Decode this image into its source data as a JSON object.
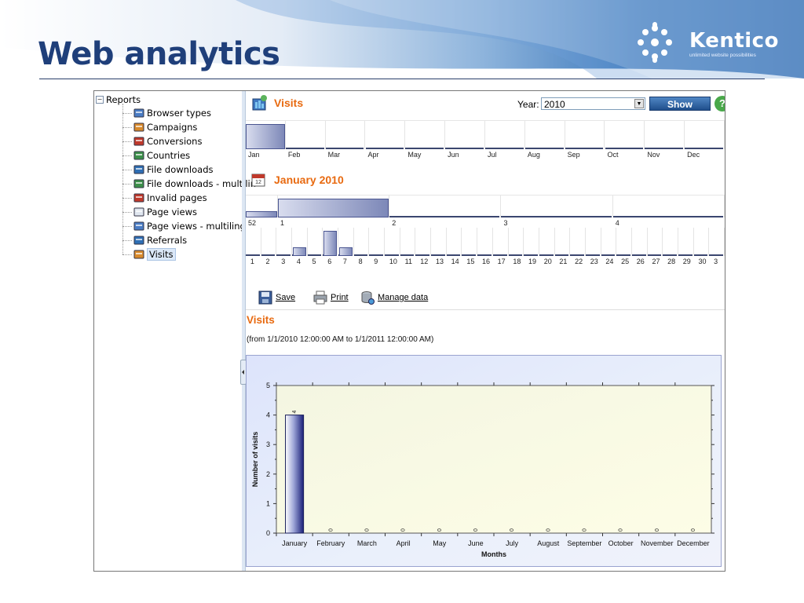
{
  "slide": {
    "title": "Web analytics",
    "logo_word": "Kentico",
    "logo_tagline": "unlimited website possibilities",
    "colors": {
      "title": "#1f3f7a",
      "accent_orange": "#e86a10",
      "bar_dark": "#1a1f78"
    }
  },
  "tree": {
    "root": "Reports",
    "toggle": "−",
    "items": [
      {
        "label": "Browser types",
        "icon": "browser-types-icon"
      },
      {
        "label": "Campaigns",
        "icon": "campaigns-icon"
      },
      {
        "label": "Conversions",
        "icon": "conversions-icon"
      },
      {
        "label": "Countries",
        "icon": "countries-icon"
      },
      {
        "label": "File downloads",
        "icon": "file-downloads-icon"
      },
      {
        "label": "File downloads - multilin",
        "icon": "file-downloads-multilingual-icon"
      },
      {
        "label": "Invalid pages",
        "icon": "invalid-pages-icon"
      },
      {
        "label": "Page views",
        "icon": "page-views-icon"
      },
      {
        "label": "Page views - multilingua",
        "icon": "page-views-multilingual-icon"
      },
      {
        "label": "Referrals",
        "icon": "referrals-icon"
      },
      {
        "label": "Visits",
        "icon": "visits-icon",
        "selected": true
      }
    ]
  },
  "header": {
    "title": "Visits",
    "year_label": "Year:",
    "year_value": "2010",
    "show_label": "Show",
    "help": "?"
  },
  "months_strip": {
    "labels": [
      "Jan",
      "Feb",
      "Mar",
      "Apr",
      "May",
      "Jun",
      "Jul",
      "Aug",
      "Sep",
      "Oct",
      "Nov",
      "Dec"
    ],
    "values": [
      4,
      0,
      0,
      0,
      0,
      0,
      0,
      0,
      0,
      0,
      0,
      0
    ]
  },
  "month_header": {
    "title": "January 2010"
  },
  "weeks_strip": {
    "labels": [
      "52",
      "1",
      "2",
      "3",
      "4"
    ],
    "values": [
      1,
      3,
      0,
      0,
      0
    ]
  },
  "days_strip": {
    "labels": [
      "1",
      "2",
      "3",
      "4",
      "5",
      "6",
      "7",
      "8",
      "9",
      "10",
      "11",
      "12",
      "13",
      "14",
      "15",
      "16",
      "17",
      "18",
      "19",
      "20",
      "21",
      "22",
      "23",
      "24",
      "25",
      "26",
      "27",
      "28",
      "29",
      "30",
      "3"
    ],
    "values": [
      0,
      0,
      0,
      1,
      0,
      3,
      1,
      0,
      0,
      0,
      0,
      0,
      0,
      0,
      0,
      0,
      0,
      0,
      0,
      0,
      0,
      0,
      0,
      0,
      0,
      0,
      0,
      0,
      0,
      0,
      0
    ]
  },
  "toolbar": {
    "save_label": "Save",
    "print_label": "Print",
    "manage_label": "Manage data"
  },
  "report": {
    "title": "Visits",
    "range": "(from 1/1/2010 12:00:00 AM to 1/1/2011 12:00:00 AM)"
  },
  "chart_data": {
    "type": "bar",
    "categories": [
      "January",
      "February",
      "March",
      "April",
      "May",
      "June",
      "July",
      "August",
      "September",
      "October",
      "November",
      "December"
    ],
    "values": [
      4,
      0,
      0,
      0,
      0,
      0,
      0,
      0,
      0,
      0,
      0,
      0
    ],
    "title": "",
    "xlabel": "Months",
    "ylabel": "Number of visits",
    "ylim": [
      0,
      5
    ],
    "yticks": [
      0,
      1,
      2,
      3,
      4,
      5
    ],
    "grid": false,
    "data_labels": true
  }
}
